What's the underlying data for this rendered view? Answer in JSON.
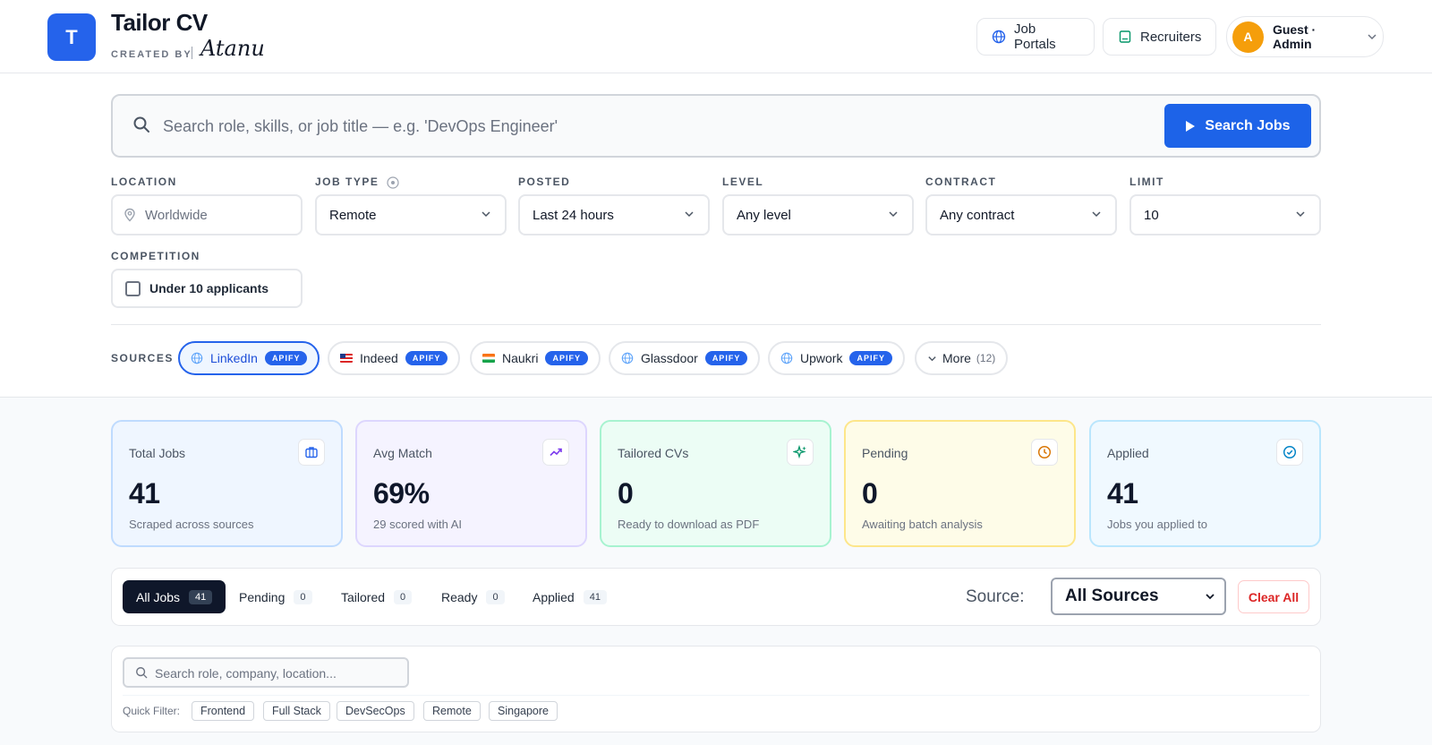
{
  "header": {
    "logo_letter": "T",
    "brand": "Tailor CV",
    "created_by": "CREATED BY",
    "signature": "Atanu",
    "job_portals": "Job Portals",
    "recruiters": "Recruiters",
    "user_initial": "A",
    "user_name": "Guest · Admin"
  },
  "search": {
    "placeholder": "Search role, skills, or job title — e.g. 'DevOps Engineer'",
    "button": "Search Jobs"
  },
  "filters": {
    "location": {
      "label": "LOCATION",
      "placeholder": "Worldwide"
    },
    "job_type": {
      "label": "JOB TYPE",
      "value": "Remote"
    },
    "posted": {
      "label": "POSTED",
      "value": "Last 24 hours"
    },
    "level": {
      "label": "LEVEL",
      "value": "Any level"
    },
    "contract": {
      "label": "CONTRACT",
      "value": "Any contract"
    },
    "limit": {
      "label": "LIMIT",
      "value": "10"
    },
    "competition": {
      "label": "COMPETITION",
      "option": "Under 10 applicants"
    }
  },
  "sources": {
    "label": "SOURCES",
    "items": [
      {
        "name": "LinkedIn",
        "badge": "APIFY"
      },
      {
        "name": "Indeed",
        "badge": "APIFY"
      },
      {
        "name": "Naukri",
        "badge": "APIFY"
      },
      {
        "name": "Glassdoor",
        "badge": "APIFY"
      },
      {
        "name": "Upwork",
        "badge": "APIFY"
      }
    ],
    "more_label": "More",
    "more_count": "(12)"
  },
  "stats": [
    {
      "label": "Total Jobs",
      "value": "41",
      "sub": "Scraped across sources"
    },
    {
      "label": "Avg Match",
      "value": "69%",
      "sub": "29 scored with AI"
    },
    {
      "label": "Tailored CVs",
      "value": "0",
      "sub": "Ready to download as PDF"
    },
    {
      "label": "Pending",
      "value": "0",
      "sub": "Awaiting batch analysis"
    },
    {
      "label": "Applied",
      "value": "41",
      "sub": "Jobs you applied to"
    }
  ],
  "tabs": [
    {
      "label": "All Jobs",
      "count": "41"
    },
    {
      "label": "Pending",
      "count": "0"
    },
    {
      "label": "Tailored",
      "count": "0"
    },
    {
      "label": "Ready",
      "count": "0"
    },
    {
      "label": "Applied",
      "count": "41"
    }
  ],
  "source_filter": {
    "label": "Source:",
    "value": "All Sources"
  },
  "clear_all": "Clear All",
  "list_search": {
    "placeholder": "Search role, company, location..."
  },
  "quick_filter": {
    "label": "Quick Filter:",
    "items": [
      "Frontend",
      "Full Stack",
      "DevSecOps",
      "Remote",
      "Singapore"
    ]
  }
}
